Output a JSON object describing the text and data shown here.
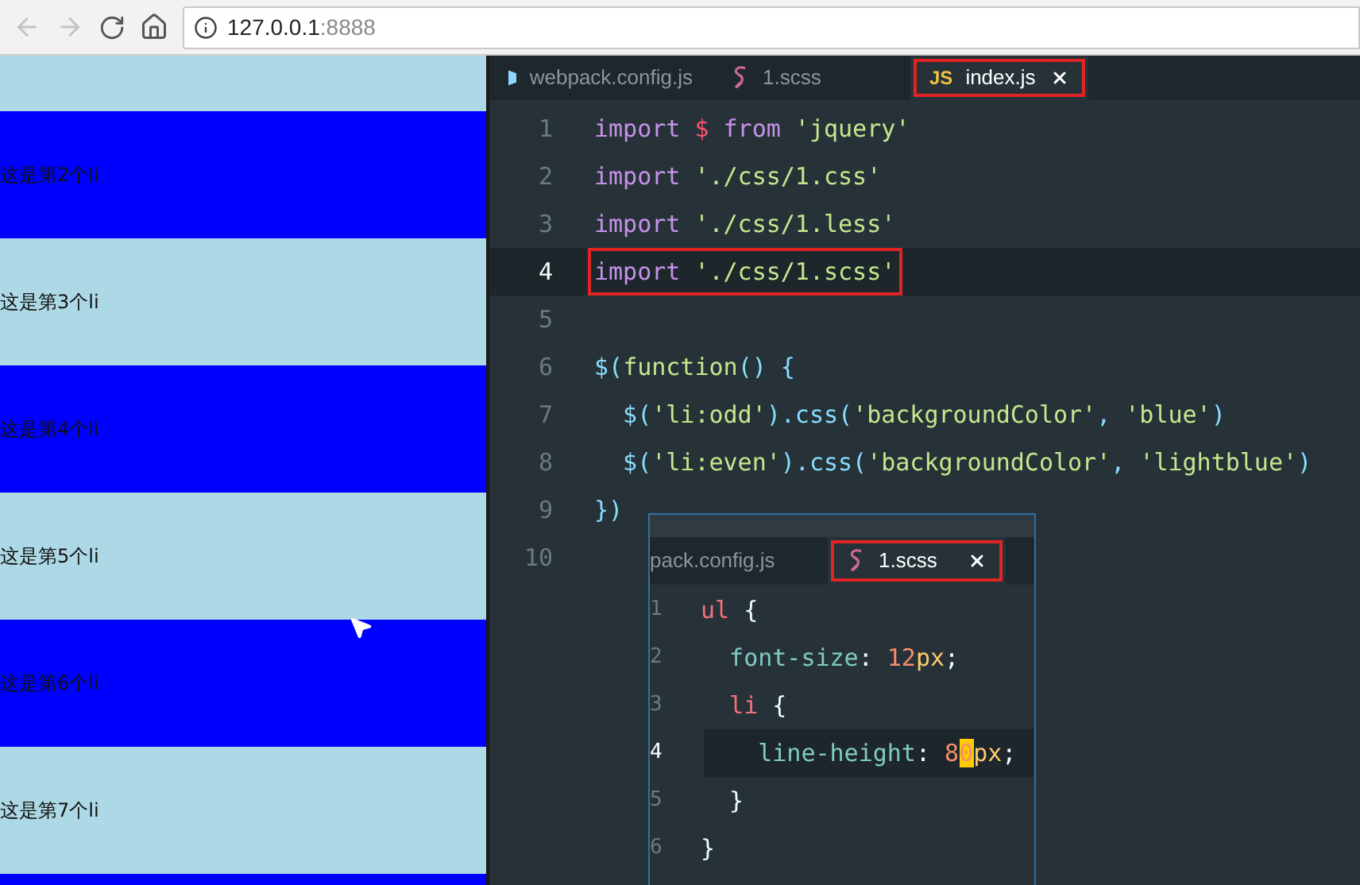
{
  "browser": {
    "address": {
      "host": "127.0.0.1",
      "port": ":8888"
    },
    "list_items": [
      {
        "color": "#add8e6"
      },
      {
        "color": "#0000ff",
        "text": "这是第2个li"
      },
      {
        "color": "#add8e6",
        "text": "这是第3个li"
      },
      {
        "color": "#0000ff",
        "text": "这是第4个li"
      },
      {
        "color": "#add8e6",
        "text": "这是第5个li"
      },
      {
        "color": "#0000ff",
        "text": "这是第6个li"
      },
      {
        "color": "#add8e6",
        "text": "这是第7个li"
      },
      {
        "color": "#0000ff"
      }
    ]
  },
  "editor": {
    "tabs": [
      {
        "label": "webpack.config.js",
        "kind": "config",
        "selected": false,
        "highlighted": false,
        "closable": false
      },
      {
        "label": "1.scss",
        "kind": "style",
        "selected": false,
        "highlighted": false,
        "closable": false
      },
      {
        "label": "index.js",
        "kind": "script",
        "badge": "JS",
        "selected": true,
        "highlighted": true,
        "closable": true
      }
    ],
    "lines": [
      {
        "number": "1",
        "current": false,
        "boxed": false,
        "tokens": [
          {
            "text": "import",
            "kind": "keyword"
          },
          {
            "text": " $",
            "kind": "variable"
          },
          {
            "text": " from",
            "kind": "keyword"
          },
          {
            "text": " 'jquery'",
            "kind": "string"
          }
        ]
      },
      {
        "number": "2",
        "current": false,
        "boxed": false,
        "tokens": [
          {
            "text": "import",
            "kind": "keyword"
          },
          {
            "text": " './css/1.css'",
            "kind": "string"
          }
        ]
      },
      {
        "number": "3",
        "current": false,
        "boxed": false,
        "tokens": [
          {
            "text": "import",
            "kind": "keyword"
          },
          {
            "text": " './css/1.less'",
            "kind": "string"
          }
        ]
      },
      {
        "number": "4",
        "current": true,
        "boxed": true,
        "tokens": [
          {
            "text": "import",
            "kind": "keyword"
          },
          {
            "text": " './css/1.scss'",
            "kind": "string"
          }
        ]
      },
      {
        "number": "5",
        "current": false,
        "boxed": false
      },
      {
        "number": "6",
        "current": false,
        "boxed": false,
        "tokens": [
          {
            "text": "$(",
            "kind": "punct"
          },
          {
            "text": "function",
            "kind": "function"
          },
          {
            "text": "() {",
            "kind": "punct"
          }
        ]
      },
      {
        "number": "7",
        "current": false,
        "boxed": false,
        "tokens": [
          {
            "text": "  $(",
            "kind": "punct"
          },
          {
            "text": "'li:odd'",
            "kind": "string"
          },
          {
            "text": ").css(",
            "kind": "punct"
          },
          {
            "text": "'backgroundColor'",
            "kind": "string"
          },
          {
            "text": ", ",
            "kind": "punct"
          },
          {
            "text": "'blue'",
            "kind": "string"
          },
          {
            "text": ")",
            "kind": "punct"
          }
        ]
      },
      {
        "number": "8",
        "current": false,
        "boxed": false,
        "tokens": [
          {
            "text": "  $(",
            "kind": "punct"
          },
          {
            "text": "'li:even'",
            "kind": "string"
          },
          {
            "text": ").css(",
            "kind": "punct"
          },
          {
            "text": "'backgroundColor'",
            "kind": "string"
          },
          {
            "text": ", ",
            "kind": "punct"
          },
          {
            "text": "'lightblue'",
            "kind": "string"
          },
          {
            "text": ")",
            "kind": "punct"
          }
        ]
      },
      {
        "number": "9",
        "current": false,
        "boxed": false,
        "tokens": [
          {
            "text": "})",
            "kind": "punct"
          }
        ]
      },
      {
        "number": "10",
        "current": false,
        "boxed": false
      }
    ]
  },
  "popup": {
    "tabs": [
      {
        "label": "pack.config.js",
        "kind": "plain",
        "selected": false,
        "highlighted": false,
        "closable": false
      },
      {
        "label": "1.scss",
        "kind": "style",
        "selected": true,
        "highlighted": true,
        "closable": true
      }
    ],
    "lines": [
      {
        "number": "1",
        "current": false,
        "tokens": [
          {
            "text": "ul",
            "kind": "selector"
          },
          {
            "text": " {",
            "kind": "plain"
          }
        ]
      },
      {
        "number": "2",
        "current": false,
        "tokens": [
          {
            "text": "  font-size",
            "kind": "property"
          },
          {
            "text": ": ",
            "kind": "plain"
          },
          {
            "text": "12",
            "kind": "number"
          },
          {
            "text": "px",
            "kind": "unit"
          },
          {
            "text": ";",
            "kind": "plain"
          }
        ]
      },
      {
        "number": "3",
        "current": false,
        "tokens": [
          {
            "text": "  li",
            "kind": "selector"
          },
          {
            "text": " {",
            "kind": "plain"
          }
        ]
      },
      {
        "number": "4",
        "current": true,
        "tokens": [
          {
            "text": "    line-height",
            "kind": "property"
          },
          {
            "text": ": ",
            "kind": "plain"
          },
          {
            "text": "8",
            "kind": "number"
          },
          {
            "text": "0",
            "kind": "cursor"
          },
          {
            "text": "px",
            "kind": "unit"
          },
          {
            "text": ";",
            "kind": "plain"
          }
        ]
      },
      {
        "number": "5",
        "current": false,
        "tokens": [
          {
            "text": "  }",
            "kind": "plain"
          }
        ]
      },
      {
        "number": "6",
        "current": false,
        "tokens": [
          {
            "text": "}",
            "kind": "plain"
          }
        ]
      }
    ]
  }
}
